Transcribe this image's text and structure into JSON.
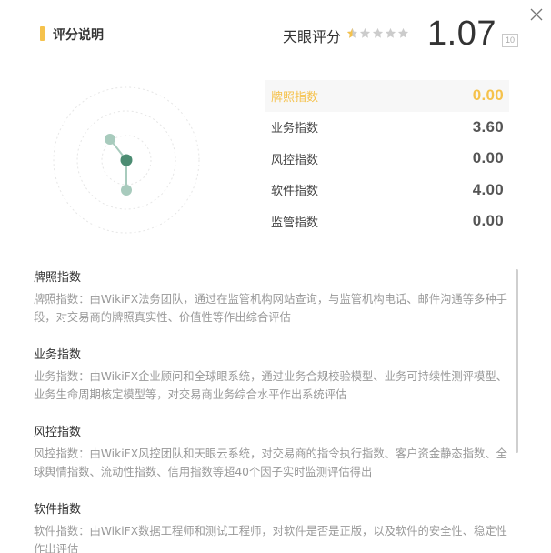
{
  "header": {
    "title": "评分说明",
    "tianyan_label": "天眼评分",
    "score": "1.07",
    "scale_max": "10",
    "stars": [
      {
        "fill": "half",
        "color": "#f5c24c"
      },
      {
        "fill": "empty",
        "color": "#cccccc"
      },
      {
        "fill": "empty",
        "color": "#cccccc"
      },
      {
        "fill": "empty",
        "color": "#cccccc"
      },
      {
        "fill": "empty",
        "color": "#cccccc"
      }
    ]
  },
  "metrics": [
    {
      "name": "牌照指数",
      "value": "0.00",
      "active": true
    },
    {
      "name": "业务指数",
      "value": "3.60",
      "active": false
    },
    {
      "name": "风控指数",
      "value": "0.00",
      "active": false
    },
    {
      "name": "软件指数",
      "value": "4.00",
      "active": false
    },
    {
      "name": "监管指数",
      "value": "0.00",
      "active": false
    }
  ],
  "sections": [
    {
      "title": "牌照指数",
      "body": "牌照指数：由WikiFX法务团队，通过在监管机构网站查询，与监管机构电话、邮件沟通等多种手段，对交易商的牌照真实性、价值性等作出综合评估"
    },
    {
      "title": "业务指数",
      "body": "业务指数：由WikiFX企业顾问和全球眼系统，通过业务合规校验模型、业务可持续性测评模型、业务生命周期核定模型等，对交易商业务综合水平作出系统评估"
    },
    {
      "title": "风控指数",
      "body": "风控指数：由WikiFX风控团队和天眼云系统，对交易商的指令执行指数、客户资金静态指数、全球舆情指数、流动性指数、信用指数等超40个因子实时监测评估得出"
    },
    {
      "title": "软件指数",
      "body": "软件指数：由WikiFX数据工程师和测试工程师，对软件是否是正版，以及软件的安全性、稳定性作出评估"
    }
  ],
  "colors": {
    "accent": "#f5c24c",
    "radar_dark": "#4c8c72",
    "radar_light": "#a8cbbd"
  }
}
